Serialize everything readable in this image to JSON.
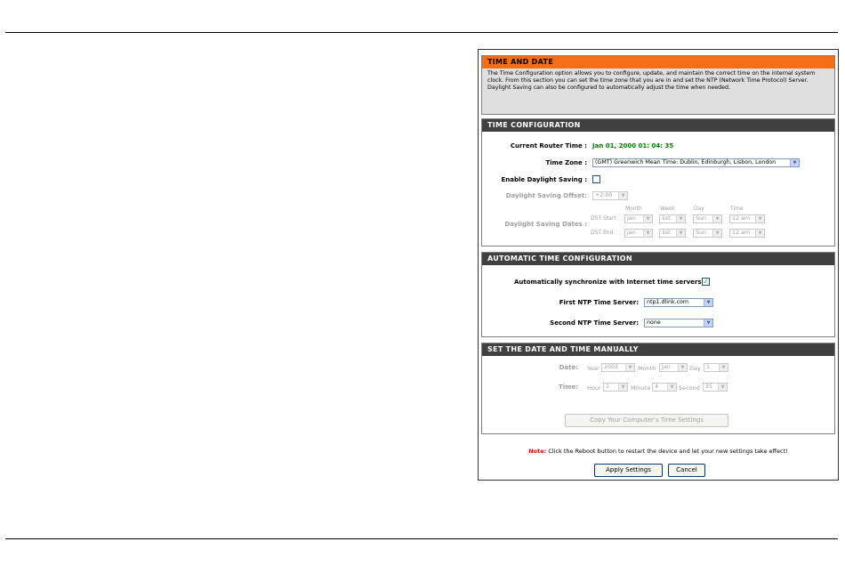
{
  "intro": {
    "title": "TIME AND DATE",
    "description": "The Time Configuration option allows you to configure, update, and maintain the correct time on the internal system clock. From this section you can set the time zone that you are in and set the NTP (Network Time Protocol) Server. Daylight Saving can also be configured to automatically adjust the time when needed."
  },
  "time_config": {
    "title": "TIME CONFIGURATION",
    "current_time_label": "Current Router Time :",
    "current_time_value": "Jan 01, 2000 01: 04: 35",
    "timezone_label": "Time Zone :",
    "timezone_value": "(GMT) Greenwich Mean Time: Dublin, Edinburgh, Lisbon, London",
    "dst_enable_label": "Enable Daylight Saving :",
    "dst_offset_label": "Daylight Saving Offset:",
    "dst_offset_value": "+2:00",
    "dst_dates_label": "Daylight Saving Dates :",
    "col_month": "Month",
    "col_week": "Week",
    "col_day": "Day",
    "col_time": "Time",
    "dst_start_label": "DST Start",
    "dst_end_label": "DST End",
    "start": {
      "month": "Jan",
      "week": "1st",
      "day": "Sun",
      "time": "12 am"
    },
    "end": {
      "month": "Jan",
      "week": "1st",
      "day": "Sun",
      "time": "12 am"
    }
  },
  "auto_config": {
    "title": "AUTOMATIC TIME CONFIGURATION",
    "sync_label": "Automatically synchronize with Internet time servers",
    "first_ntp_label": "First NTP Time Server:",
    "first_ntp_value": "ntp1.dlink.com",
    "second_ntp_label": "Second NTP Time Server:",
    "second_ntp_value": "none"
  },
  "manual": {
    "title": "SET THE DATE AND TIME MANUALLY",
    "date_label": "Date:",
    "year_label": "Year",
    "year_value": "2002",
    "month_label": "Month",
    "month_value": "Jan",
    "day_label": "Day",
    "day_value": "1",
    "time_label": "Time:",
    "hour_label": "Hour",
    "hour_value": "1",
    "minute_label": "Minute",
    "minute_value": "4",
    "second_label": "Second",
    "second_value": "35",
    "copy_button": "Copy Your Computer's Time Settings"
  },
  "footer": {
    "note_prefix": "Note:",
    "note_text": " Click the Reboot button to restart the device and let your new settings take effect!",
    "apply_button": "Apply Settings",
    "cancel_button": "Cancel"
  }
}
